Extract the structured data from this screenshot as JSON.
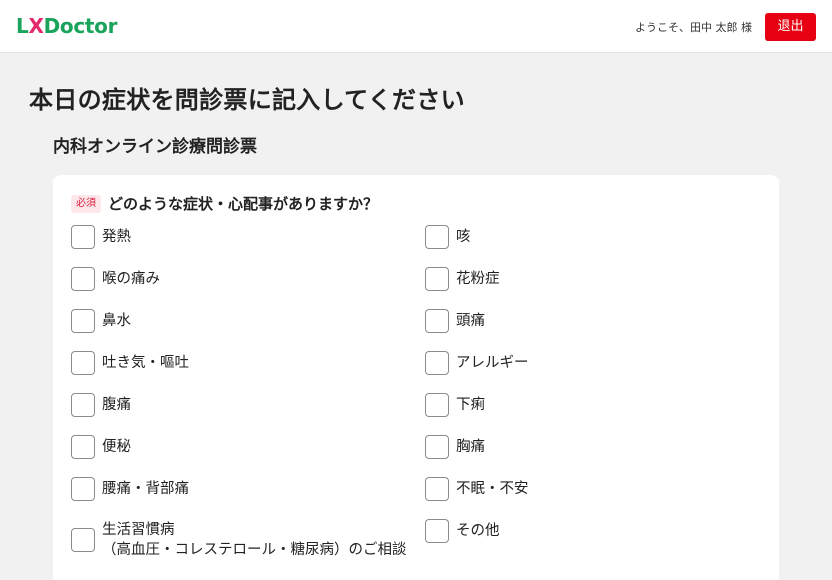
{
  "header": {
    "logo": {
      "part1": "L",
      "part2": "X",
      "part3": "Doctor"
    },
    "welcome": "ようこそ、田中 太郎 様",
    "logout_label": "退出"
  },
  "page": {
    "title": "本日の症状を問診票に記入してください",
    "form_title": "内科オンライン診療問診票"
  },
  "question": {
    "required_label": "必須",
    "text": "どのような症状・心配事がありますか？"
  },
  "options_left": [
    "発熱",
    "喉の痛み",
    "鼻水",
    "吐き気・嘔吐",
    "腹痛",
    "便秘",
    "腰痛・背部痛",
    "生活習慣病\n（高血圧・コレステロール・糖尿病）のご相談"
  ],
  "options_right": [
    "咳",
    "花粉症",
    "頭痛",
    "アレルギー",
    "下痢",
    "胸痛",
    "不眠・不安",
    "その他"
  ],
  "colors": {
    "brand_green": "#1aa35a",
    "brand_pink": "#e3286b",
    "logout_red": "#e60012",
    "required_bg": "#fde7ea",
    "required_text": "#d81e3c"
  }
}
